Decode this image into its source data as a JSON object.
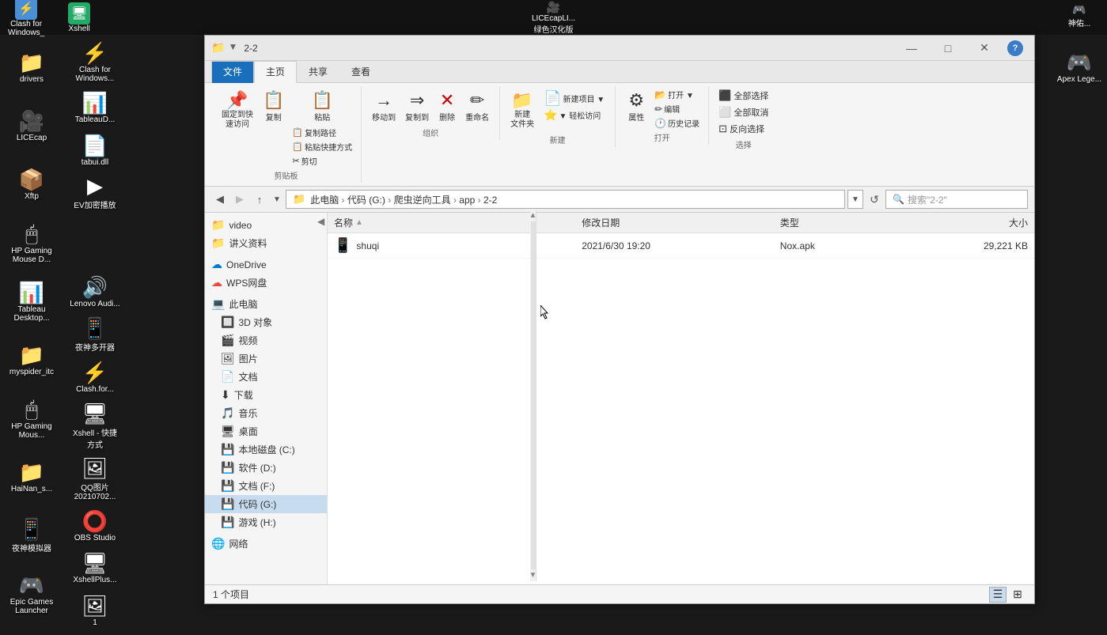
{
  "taskbar": {
    "apps": [
      {
        "id": "clash",
        "label": "Clash for\nWindows_",
        "icon": "⚡",
        "color": "#4a90d9"
      },
      {
        "id": "xshell",
        "label": "Xshell",
        "icon": "🖥",
        "color": "#333"
      }
    ]
  },
  "desktop_icons_col1": [
    {
      "id": "drivers",
      "label": "drivers",
      "icon": "📁",
      "color": "#ffd700"
    },
    {
      "id": "licecap",
      "label": "LICEcap",
      "icon": "🎥",
      "color": "#4a90d9"
    },
    {
      "id": "xftp",
      "label": "Xftp",
      "icon": "📦",
      "color": "#3a7"
    },
    {
      "id": "hp-gaming",
      "label": "HP Gaming\nMouse D...",
      "icon": "🖱",
      "color": "#666"
    },
    {
      "id": "tableau-desktop",
      "label": "Tableau\nDesktop ...",
      "icon": "📊",
      "color": "#1f77b4"
    },
    {
      "id": "myspider",
      "label": "myspider_itc",
      "icon": "📁",
      "color": "#ffd700"
    },
    {
      "id": "hp-gaming2",
      "label": "HP Gaming\nMous...",
      "icon": "🖱",
      "color": "#888"
    },
    {
      "id": "hainan",
      "label": "HaiNan_s...",
      "icon": "📁",
      "color": "#ffd700"
    },
    {
      "id": "yeshen",
      "label": "夜神模拟器",
      "icon": "📱",
      "color": "#1a8"
    },
    {
      "id": "epic",
      "label": "Epic Games\nLauncher",
      "icon": "🎮",
      "color": "#333"
    },
    {
      "id": "lenovo",
      "label": "Lenovo\nAudi...",
      "icon": "🔊",
      "color": "#e74c3c"
    },
    {
      "id": "yeshen2",
      "label": "夜神多开器",
      "icon": "📱",
      "color": "#1a8"
    },
    {
      "id": "clash2",
      "label": "Clash.for...",
      "icon": "⚡",
      "color": "#4a90d9"
    },
    {
      "id": "xshell2",
      "label": "Xshell - 快捷\n方式",
      "icon": "🖥",
      "color": "#333"
    },
    {
      "id": "qqpics",
      "label": "QQ图片\n20210702...",
      "icon": "🖼",
      "color": "#888"
    },
    {
      "id": "obs",
      "label": "OBS Studio",
      "icon": "⭕",
      "color": "#333"
    },
    {
      "id": "xshellplus",
      "label": "XshellPlus...",
      "icon": "🖥",
      "color": "#333"
    },
    {
      "id": "gif1",
      "label": "1",
      "icon": "🖼",
      "color": "#aaa"
    }
  ],
  "desktop_icons_col2": [
    {
      "id": "clash-col2",
      "label": "Clash for\nWindows...",
      "icon": "⚡",
      "color": "#4a90d9"
    },
    {
      "id": "tableau-col2",
      "label": "TableauD...",
      "icon": "📊",
      "color": "#1f77b4"
    },
    {
      "id": "tabui",
      "label": "tabui.dll",
      "icon": "📄",
      "color": "#888"
    },
    {
      "id": "ev",
      "label": "EV加密播放",
      "icon": "▶",
      "color": "#4a90d9"
    }
  ],
  "explorer": {
    "title": "2-2",
    "window_controls": {
      "minimize": "—",
      "maximize": "□",
      "close": "✕"
    },
    "ribbon_tabs": [
      "文件",
      "主页",
      "共享",
      "查看"
    ],
    "active_tab": "主页",
    "ribbon_groups": {
      "clipboard": {
        "label": "剪贴板",
        "buttons": [
          {
            "id": "pin",
            "label": "固定到快\n速访问",
            "icon": "📌"
          },
          {
            "id": "copy",
            "label": "复制",
            "icon": "📋"
          },
          {
            "id": "paste",
            "label": "粘贴",
            "icon": "📋"
          },
          {
            "id": "cut",
            "label": "✂ 剪切",
            "icon": ""
          }
        ],
        "paste_sub": [
          "粘贴快捷方式"
        ]
      },
      "organize": {
        "label": "组织",
        "buttons": [
          {
            "id": "move-to",
            "label": "移动到"
          },
          {
            "id": "copy-to",
            "label": "复制到"
          },
          {
            "id": "delete",
            "label": "删除",
            "icon": "✕"
          },
          {
            "id": "rename",
            "label": "重命名"
          }
        ]
      },
      "new": {
        "label": "新建",
        "buttons": [
          {
            "id": "new-folder",
            "label": "新建\n文件夹",
            "icon": "📁"
          },
          {
            "id": "new-item",
            "label": "新建项目▼",
            "icon": ""
          }
        ],
        "easy-access": "▼ 轻松访问"
      },
      "open": {
        "label": "打开",
        "buttons": [
          {
            "id": "properties",
            "label": "属性",
            "icon": "⚙"
          },
          {
            "id": "open",
            "label": "打开▼",
            "icon": "📂"
          },
          {
            "id": "edit",
            "label": "编辑",
            "icon": "✏"
          },
          {
            "id": "history",
            "label": "历史记录",
            "icon": "🕐"
          }
        ]
      },
      "select": {
        "label": "选择",
        "buttons": [
          {
            "id": "select-all",
            "label": "全部选择"
          },
          {
            "id": "select-none",
            "label": "全部取消"
          },
          {
            "id": "invert",
            "label": "反向选择"
          }
        ]
      }
    },
    "address_bar": {
      "breadcrumb": "此电脑 ＞ 代码 (G:) ＞ 爬虫逆向工具 ＞ app ＞ 2-2",
      "parts": [
        "此电脑",
        "代码 (G:)",
        "爬虫逆向工具",
        "app",
        "2-2"
      ],
      "search_placeholder": "搜索\"2-2\""
    },
    "sidebar": {
      "items": [
        {
          "id": "video",
          "label": "video",
          "icon": "📁",
          "indent": 0
        },
        {
          "id": "jiangyi",
          "label": "讲义资料",
          "icon": "📁",
          "indent": 0
        },
        {
          "id": "onedrive",
          "label": "OneDrive",
          "icon": "☁",
          "indent": 0
        },
        {
          "id": "wps",
          "label": "WPS网盘",
          "icon": "☁",
          "indent": 0
        },
        {
          "id": "thispc",
          "label": "此电脑",
          "icon": "💻",
          "indent": 0
        },
        {
          "id": "3d",
          "label": "3D 对象",
          "icon": "🔲",
          "indent": 1
        },
        {
          "id": "video2",
          "label": "视频",
          "icon": "🎬",
          "indent": 1
        },
        {
          "id": "pics",
          "label": "图片",
          "icon": "🖼",
          "indent": 1
        },
        {
          "id": "docs",
          "label": "文档",
          "icon": "📄",
          "indent": 1
        },
        {
          "id": "downloads",
          "label": "下载",
          "icon": "⬇",
          "indent": 1
        },
        {
          "id": "music",
          "label": "音乐",
          "icon": "🎵",
          "indent": 1
        },
        {
          "id": "desktop",
          "label": "桌面",
          "icon": "🖥",
          "indent": 1
        },
        {
          "id": "local-c",
          "label": "本地磁盘 (C:)",
          "icon": "💾",
          "indent": 1
        },
        {
          "id": "soft-d",
          "label": "软件 (D:)",
          "icon": "💾",
          "indent": 1
        },
        {
          "id": "doc-f",
          "label": "文档 (F:)",
          "icon": "💾",
          "indent": 1
        },
        {
          "id": "code-g",
          "label": "代码 (G:)",
          "icon": "💾",
          "indent": 1,
          "active": true
        },
        {
          "id": "game-h",
          "label": "游戏 (H:)",
          "icon": "💾",
          "indent": 1
        },
        {
          "id": "network",
          "label": "网络",
          "icon": "🌐",
          "indent": 0
        }
      ]
    },
    "files": [
      {
        "id": "shuqi",
        "name": "shuqi",
        "icon": "📱",
        "date": "2021/6/30 19:20",
        "type": "Nox.apk",
        "size": "29,221 KB"
      }
    ],
    "file_headers": {
      "name": "名称",
      "date": "修改日期",
      "type": "类型",
      "size": "大小"
    },
    "status": {
      "count": "1 个项目",
      "view_detail": "☰",
      "view_large": "⊞"
    }
  },
  "right_desktop_icons": [
    {
      "id": "神佑",
      "label": "神佑...",
      "icon": "🎮",
      "color": "#e74c3c"
    },
    {
      "id": "apex",
      "label": "Apex\nLege...",
      "icon": "🎮",
      "color": "#e74c3c"
    }
  ]
}
